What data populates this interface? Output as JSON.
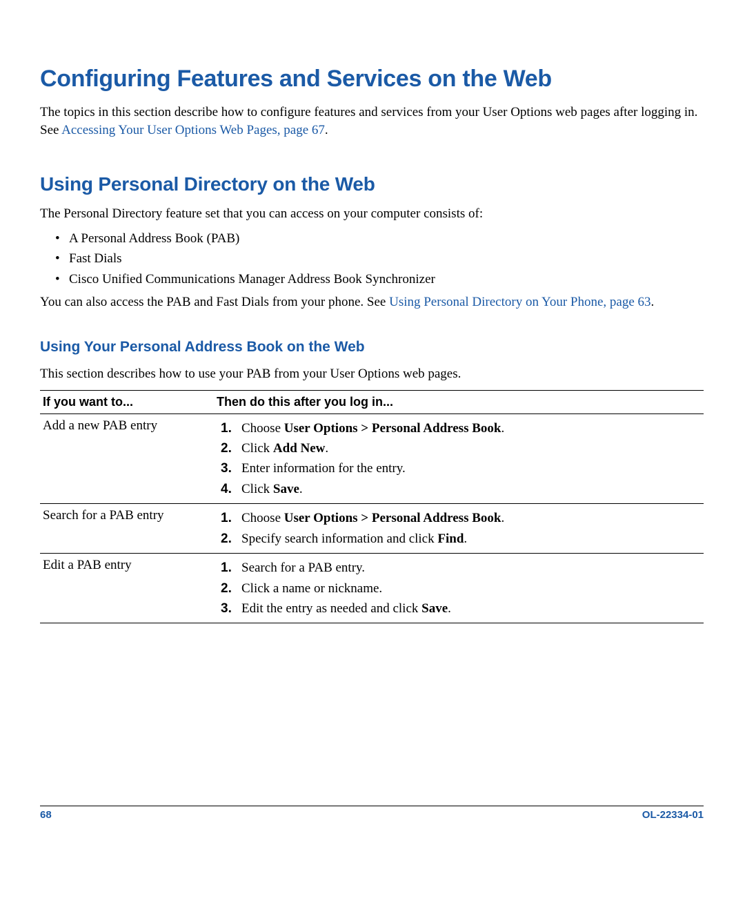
{
  "headings": {
    "h1": "Configuring Features and Services on the Web",
    "h2": "Using Personal Directory on the Web",
    "h3": "Using Your Personal Address Book on the Web"
  },
  "intro": {
    "p1_pre": "The topics in this section describe how to configure features and services from your User Options web pages after logging in. See ",
    "p1_link": "Accessing Your User Options Web Pages, page 67",
    "p1_post": "."
  },
  "pd_intro": "The Personal Directory feature set that you can access on your computer consists of:",
  "bullets": {
    "b1": "A Personal Address Book (PAB)",
    "b2": "Fast Dials",
    "b3": "Cisco Unified Communications Manager Address Book Synchronizer"
  },
  "pd_after": {
    "pre": "You can also access the PAB and Fast Dials from your phone. See ",
    "link": "Using Personal Directory on Your Phone, page 63",
    "post": "."
  },
  "pab_intro": "This section describes how to use your PAB from your User Options web pages.",
  "table": {
    "header_left": "If you want to...",
    "header_right": "Then do this after you log in...",
    "rows": {
      "r1": {
        "task": "Add a new PAB entry",
        "steps": {
          "s1_pre": "Choose ",
          "s1_bold": "User Options > Personal Address Book",
          "s1_post": ".",
          "s2_pre": "Click ",
          "s2_bold": "Add New",
          "s2_post": ".",
          "s3": "Enter information for the entry.",
          "s4_pre": "Click ",
          "s4_bold": "Save",
          "s4_post": "."
        }
      },
      "r2": {
        "task": "Search for a PAB entry",
        "steps": {
          "s1_pre": "Choose ",
          "s1_bold": "User Options > Personal Address Book",
          "s1_post": ".",
          "s2_pre": "Specify search information and click ",
          "s2_bold": "Find",
          "s2_post": "."
        }
      },
      "r3": {
        "task": "Edit a PAB entry",
        "steps": {
          "s1": "Search for a PAB entry.",
          "s2": "Click a name or nickname.",
          "s3_pre": "Edit the entry as needed and click ",
          "s3_bold": "Save",
          "s3_post": "."
        }
      }
    }
  },
  "footer": {
    "page_num": "68",
    "doc_id": "OL-22334-01"
  }
}
